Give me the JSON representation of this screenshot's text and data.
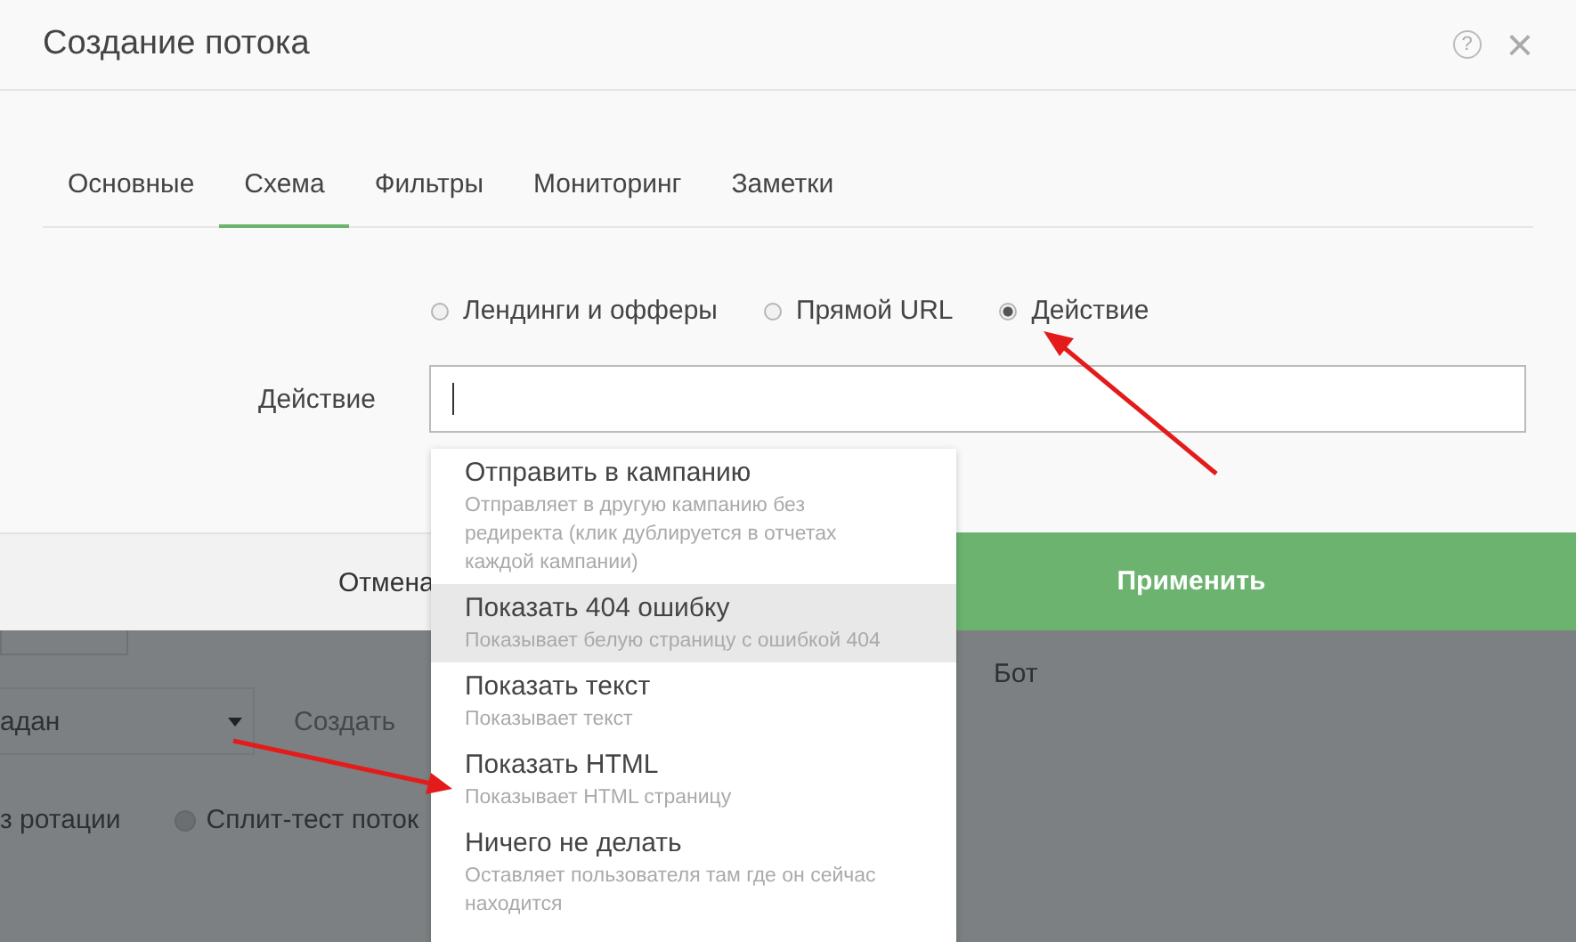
{
  "window": {
    "title": "Создание потока",
    "help_icon": "?",
    "close_icon": "×"
  },
  "tabs": [
    {
      "label": "Основные",
      "selected": false
    },
    {
      "label": "Схема",
      "selected": true
    },
    {
      "label": "Фильтры",
      "selected": false
    },
    {
      "label": "Мониторинг",
      "selected": false
    },
    {
      "label": "Заметки",
      "selected": false
    }
  ],
  "schema_options": [
    {
      "label": "Лендинги и офферы",
      "selected": false
    },
    {
      "label": "Прямой URL",
      "selected": false
    },
    {
      "label": "Действие",
      "selected": true
    }
  ],
  "action_field": {
    "label": "Действие"
  },
  "action_menu": [
    {
      "title": "Отправить в кампанию",
      "description": "Отправляет в другую кампанию без редиректа (клик дублируется в отчетах каждой кампании)",
      "highlighted": false
    },
    {
      "title": "Показать 404 ошибку",
      "description": "Показывает белую страницу с ошибкой 404",
      "highlighted": true
    },
    {
      "title": "Показать текст",
      "description": "Показывает текст",
      "highlighted": false
    },
    {
      "title": "Показать HTML",
      "description": "Показывает HTML страницу",
      "highlighted": false
    },
    {
      "title": "Ничего не делать",
      "description": "Оставляет пользователя там где он сейчас находится",
      "highlighted": false
    }
  ],
  "footer": {
    "cancel": "Отмена",
    "apply": "Применить"
  },
  "background_page": {
    "select_value": "адан",
    "create_button": "Создать",
    "rotation_label": "з ротации",
    "split_test": {
      "label": "Сплит-тест поток",
      "selected": false
    },
    "bot_label": "Бот"
  }
}
